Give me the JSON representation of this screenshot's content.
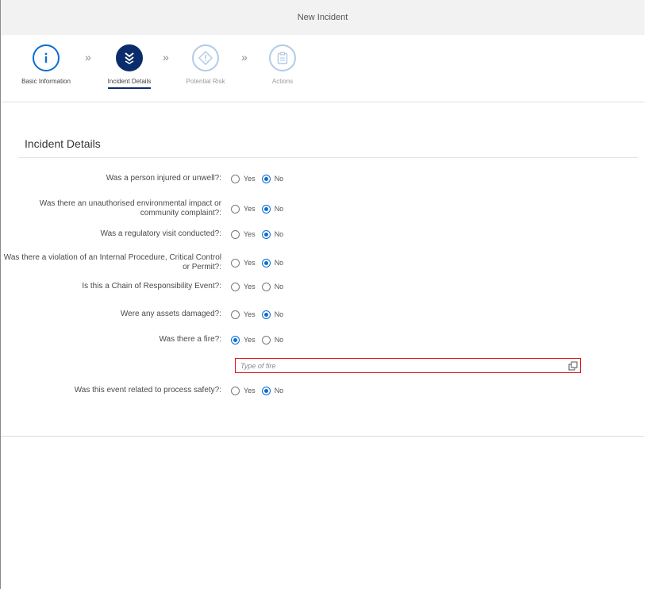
{
  "window": {
    "title": "New Incident"
  },
  "wizard": {
    "steps": [
      {
        "label": "Basic Information",
        "icon": "info-icon",
        "state": "done"
      },
      {
        "label": "Incident Details",
        "icon": "double-chevron-down-icon",
        "state": "active"
      },
      {
        "label": "Potential Risk",
        "icon": "diamond-icon",
        "state": "future"
      },
      {
        "label": "Actions",
        "icon": "clipboard-icon",
        "state": "future"
      }
    ],
    "separator": "»"
  },
  "section": {
    "title": "Incident Details"
  },
  "options": {
    "yes": "Yes",
    "no": "No"
  },
  "questions": [
    {
      "label": "Was a person injured or unwell?:",
      "selected": "No"
    },
    {
      "label": "Was there an unauthorised environmental impact or community complaint?:",
      "selected": "No"
    },
    {
      "label": "Was a regulatory visit conducted?:",
      "selected": "No"
    },
    {
      "label": "Was there a violation of an Internal Procedure, Critical Control or Permit?:",
      "selected": "No"
    },
    {
      "label": "Is this a Chain of Responsibility Event?:",
      "selected": ""
    },
    {
      "label": "Were any assets damaged?:",
      "selected": "No"
    },
    {
      "label": "Was there a fire?:",
      "selected": "Yes"
    },
    {
      "label": "Was this event related to process safety?:",
      "selected": "No"
    }
  ],
  "fire_type": {
    "placeholder": "Type of fire",
    "value": "",
    "icon": "value-help-icon"
  },
  "colors": {
    "accent": "#0a6ed1",
    "active_step": "#0a2c6b",
    "error_border": "#e0141a"
  }
}
